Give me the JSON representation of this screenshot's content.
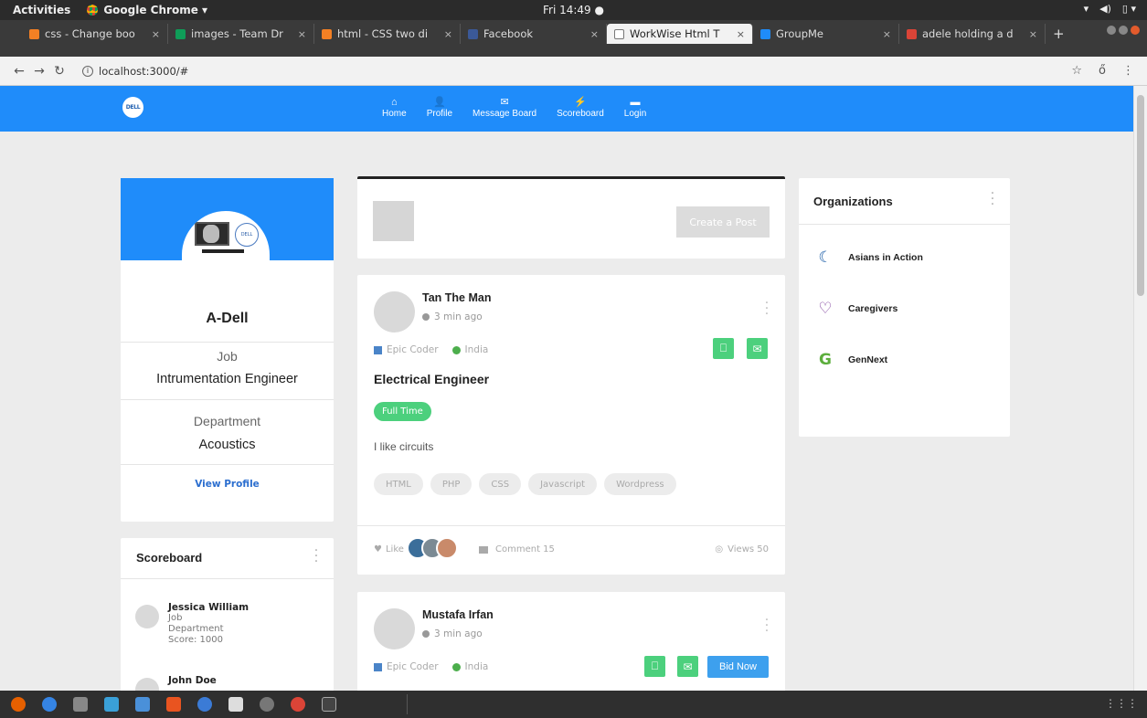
{
  "system": {
    "activities": "Activities",
    "app_name": "Google Chrome ▾",
    "clock": "Fri 14:49 ●"
  },
  "browser": {
    "tabs": [
      {
        "title": "css - Change boo",
        "icon": "stackoverflow-icon",
        "color": "#f48024"
      },
      {
        "title": "images - Team Dr",
        "icon": "google-drive-icon",
        "color": "#0f9d58"
      },
      {
        "title": "html - CSS two di",
        "icon": "stackoverflow-icon",
        "color": "#f48024"
      },
      {
        "title": "Facebook",
        "icon": "facebook-icon",
        "color": "#3b5998"
      },
      {
        "title": "WorkWise Html T",
        "icon": "page-icon",
        "color": "#ffffff"
      },
      {
        "title": "GroupMe",
        "icon": "groupme-icon",
        "color": "#1f8cfa"
      },
      {
        "title": "adele holding a d",
        "icon": "google-icon",
        "color": "#db4437"
      }
    ],
    "active_tab_index": 4,
    "url": "localhost:3000/#"
  },
  "nav": {
    "logo": "DELL",
    "items": [
      {
        "label": "Home",
        "icon": "home-icon",
        "glyph": "⌂"
      },
      {
        "label": "Profile",
        "icon": "profile-icon",
        "glyph": "👤"
      },
      {
        "label": "Message Board",
        "icon": "envelope-icon",
        "glyph": "✉"
      },
      {
        "label": "Scoreboard",
        "icon": "bolt-icon",
        "glyph": "⚡"
      },
      {
        "label": "Login",
        "icon": "briefcase-icon",
        "glyph": "▬"
      }
    ]
  },
  "profile": {
    "name": "A-Dell",
    "job_label": "Job",
    "job_value": "Intrumentation Engineer",
    "dept_label": "Department",
    "dept_value": "Acoustics",
    "view_profile": "View Profile"
  },
  "scoreboard": {
    "title": "Scoreboard",
    "rows": [
      {
        "name": "Jessica William",
        "line1": "Job",
        "line2": "Department",
        "line3": "Score: 1000"
      },
      {
        "name": "John Doe",
        "line1": "",
        "line2": "",
        "line3": ""
      }
    ]
  },
  "create_post": {
    "button": "Create a Post"
  },
  "posts": [
    {
      "author": "Tan The Man",
      "time": "3 min ago",
      "company": "Epic Coder",
      "location": "India",
      "job_title": "Electrical Engineer",
      "job_type": "Full Time",
      "description": "I like circuits",
      "tags": [
        "HTML",
        "PHP",
        "CSS",
        "Javascript",
        "Wordpress"
      ],
      "like": "Like",
      "comment": "Comment 15",
      "views": "Views 50"
    },
    {
      "author": "Mustafa Irfan",
      "time": "3 min ago",
      "company": "Epic Coder",
      "location": "India",
      "bid": "Bid Now"
    }
  ],
  "organizations": {
    "title": "Organizations",
    "items": [
      {
        "name": "Asians in Action",
        "icon": "swirl-logo-icon",
        "glyph": "☾",
        "color": "#1e5fa8"
      },
      {
        "name": "Caregivers",
        "icon": "heart-logo-icon",
        "glyph": "♡",
        "color": "#7b3a9a"
      },
      {
        "name": "GenNext",
        "icon": "g-logo-icon",
        "glyph": "G",
        "color": "#5cae3c"
      }
    ]
  },
  "colors": {
    "brand_blue": "#1f8cfa",
    "green": "#4cd07d",
    "background": "#ececec"
  }
}
